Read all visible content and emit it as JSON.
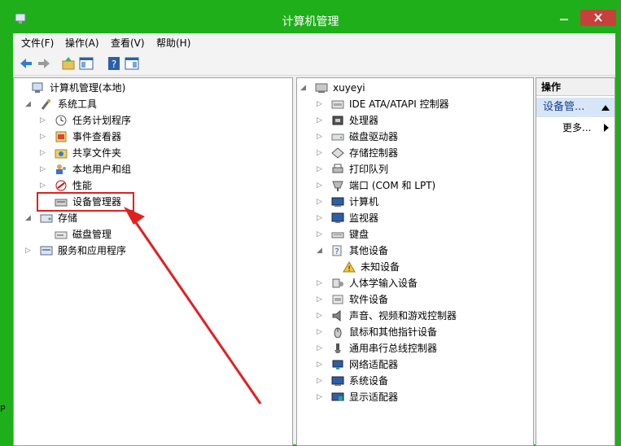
{
  "window": {
    "title": "计算机管理",
    "colors": {
      "frame": "#1faf1b",
      "close": "#c7403b",
      "highlight": "#e02020"
    }
  },
  "menu": [
    {
      "label": "文件(F)"
    },
    {
      "label": "操作(A)"
    },
    {
      "label": "查看(V)"
    },
    {
      "label": "帮助(H)"
    }
  ],
  "toolbar": {
    "icons": [
      "back-icon",
      "forward-icon",
      "up-folder-icon",
      "show-hide-tree-icon",
      "help-icon",
      "properties-icon"
    ]
  },
  "left_tree": [
    {
      "label": "计算机管理(本地)",
      "icon": "computer-mgmt-icon",
      "expander": ""
    },
    {
      "label": "系统工具",
      "icon": "tools-icon",
      "expander": "◢"
    },
    {
      "label": "任务计划程序",
      "icon": "clock-icon",
      "expander": "▷"
    },
    {
      "label": "事件查看器",
      "icon": "event-viewer-icon",
      "expander": "▷"
    },
    {
      "label": "共享文件夹",
      "icon": "shared-folder-icon",
      "expander": "▷"
    },
    {
      "label": "本地用户和组",
      "icon": "users-icon",
      "expander": "▷"
    },
    {
      "label": "性能",
      "icon": "performance-icon",
      "expander": "▷"
    },
    {
      "label": "设备管理器",
      "icon": "device-manager-icon",
      "expander": ""
    },
    {
      "label": "存储",
      "icon": "storage-icon",
      "expander": "◢"
    },
    {
      "label": "磁盘管理",
      "icon": "disk-mgmt-icon",
      "expander": ""
    },
    {
      "label": "服务和应用程序",
      "icon": "services-icon",
      "expander": "▷"
    }
  ],
  "device_tree": {
    "root": "xuyeyi",
    "items": [
      {
        "label": "IDE ATA/ATAPI 控制器",
        "icon": "ide-icon",
        "expander": "▷"
      },
      {
        "label": "处理器",
        "icon": "cpu-icon",
        "expander": "▷"
      },
      {
        "label": "磁盘驱动器",
        "icon": "disk-drive-icon",
        "expander": "▷"
      },
      {
        "label": "存储控制器",
        "icon": "storage-controller-icon",
        "expander": "▷"
      },
      {
        "label": "打印队列",
        "icon": "printer-icon",
        "expander": "▷"
      },
      {
        "label": "端口 (COM 和 LPT)",
        "icon": "port-icon",
        "expander": "▷"
      },
      {
        "label": "计算机",
        "icon": "computer-icon",
        "expander": "▷"
      },
      {
        "label": "监视器",
        "icon": "monitor-icon",
        "expander": "▷"
      },
      {
        "label": "键盘",
        "icon": "keyboard-icon",
        "expander": "▷"
      },
      {
        "label": "其他设备",
        "icon": "other-devices-icon",
        "expander": "◢"
      },
      {
        "label": "未知设备",
        "icon": "unknown-device-icon",
        "expander": ""
      },
      {
        "label": "人体学输入设备",
        "icon": "hid-icon",
        "expander": "▷"
      },
      {
        "label": "软件设备",
        "icon": "software-device-icon",
        "expander": "▷"
      },
      {
        "label": "声音、视频和游戏控制器",
        "icon": "sound-icon",
        "expander": "▷"
      },
      {
        "label": "鼠标和其他指针设备",
        "icon": "mouse-icon",
        "expander": "▷"
      },
      {
        "label": "通用串行总线控制器",
        "icon": "usb-icon",
        "expander": "▷"
      },
      {
        "label": "网络适配器",
        "icon": "network-icon",
        "expander": "▷"
      },
      {
        "label": "系统设备",
        "icon": "system-device-icon",
        "expander": "▷"
      },
      {
        "label": "显示适配器",
        "icon": "display-adapter-icon",
        "expander": "▷"
      }
    ]
  },
  "actions": {
    "header": "操作",
    "item": "设备管...",
    "more": "更多..."
  },
  "edge_text": "P"
}
